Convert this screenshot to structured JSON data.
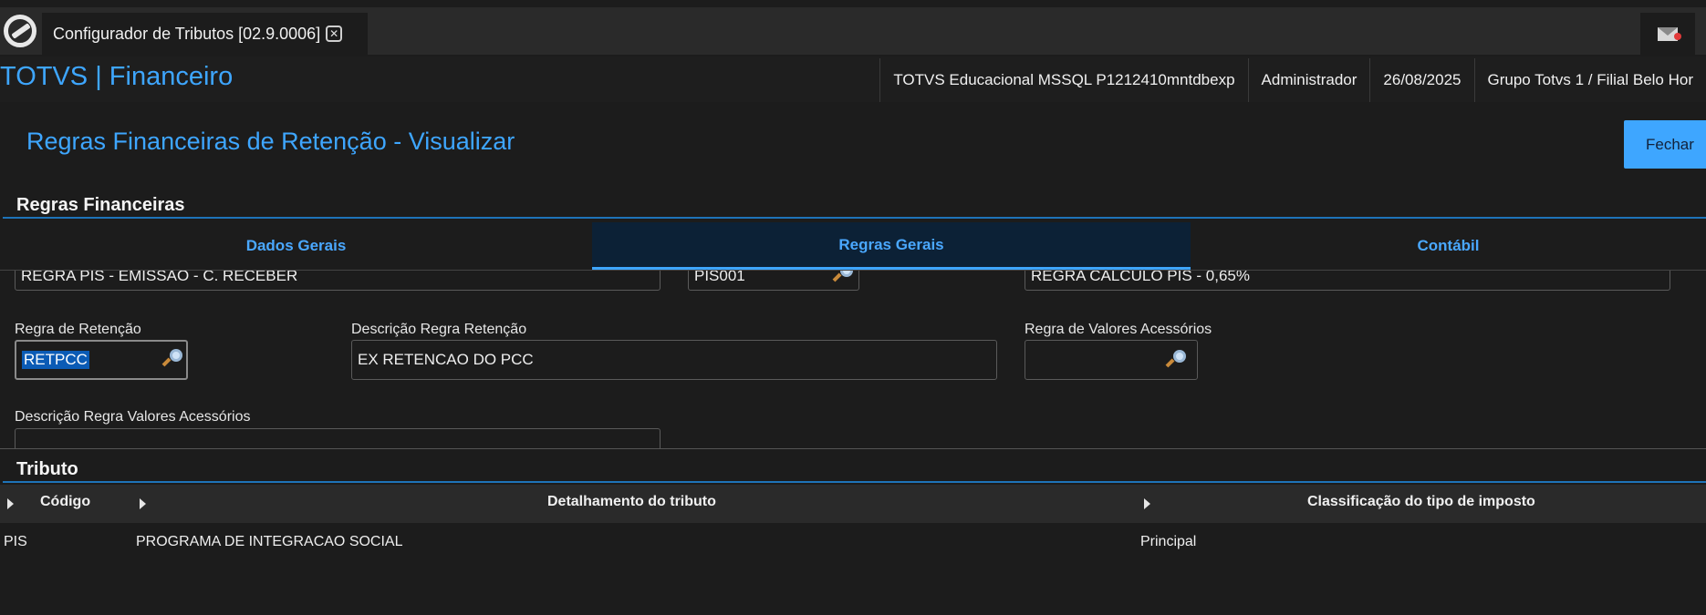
{
  "tab": {
    "title": "Configurador de Tributos [02.9.0006]"
  },
  "header": {
    "app_title": "TOTVS | Financeiro",
    "environment": "TOTVS Educacional MSSQL P1212410mntdbexp",
    "user": "Administrador",
    "date": "26/08/2025",
    "branch": "Grupo Totvs 1 / Filial Belo Hor"
  },
  "page": {
    "title": "Regras Financeiras de Retenção - Visualizar",
    "close_label": "Fechar"
  },
  "sections": {
    "regras": "Regras Financeiras",
    "tributo": "Tributo"
  },
  "tabs": [
    {
      "label": "Dados Gerais",
      "active": false
    },
    {
      "label": "Regras Gerais",
      "active": true
    },
    {
      "label": "Contábil",
      "active": false
    }
  ],
  "form": {
    "row0": {
      "descricao": "REGRA PIS - EMISSÃO - C. RECEBER",
      "codigo": "PIS001",
      "regra_calculo": "REGRA CÁLCULO PIS - 0,65%"
    },
    "regra_retencao": {
      "label": "Regra de Retenção",
      "value": "RETPCC"
    },
    "desc_regra_retencao": {
      "label": "Descrição Regra Retenção",
      "value": "EX RETENCAO DO PCC"
    },
    "regra_valores_acessorios": {
      "label": "Regra de Valores Acessórios",
      "value": ""
    },
    "desc_regra_valores_acessorios": {
      "label": "Descrição Regra Valores Acessórios",
      "value": ""
    }
  },
  "grid": {
    "columns": [
      "Código",
      "Detalhamento do tributo",
      "Classificação do tipo de imposto"
    ],
    "rows": [
      [
        "PIS",
        "PROGRAMA DE INTEGRACAO SOCIAL",
        "Principal"
      ]
    ]
  },
  "colors": {
    "accent": "#3ea6ff",
    "background": "#1c1c1c",
    "active_tab": "#0c2136"
  },
  "icons": [
    "app-logo-icon",
    "close-tab-icon",
    "mail-icon",
    "search-icon",
    "sort-arrow-icon"
  ]
}
